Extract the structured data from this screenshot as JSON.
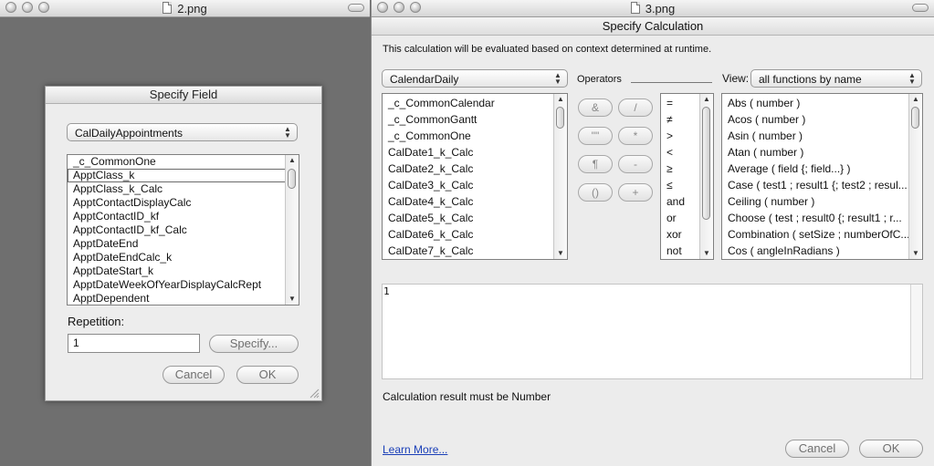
{
  "left_window": {
    "title": "2.png"
  },
  "right_window": {
    "title": "3.png"
  },
  "specify_field": {
    "title": "Specify Field",
    "table_popup": "CalDailyAppointments",
    "fields": [
      "_c_CommonOne",
      "ApptClass_k",
      "ApptClass_k_Calc",
      "ApptContactDisplayCalc",
      "ApptContactID_kf",
      "ApptContactID_kf_Calc",
      "ApptDateEnd",
      "ApptDateEndCalc_k",
      "ApptDateStart_k",
      "ApptDateWeekOfYearDisplayCalcRept",
      "ApptDependent"
    ],
    "selected_field": "ApptClass_k",
    "repetition_label": "Repetition:",
    "repetition_value": "1",
    "specify_button": "Specify...",
    "cancel_button": "Cancel",
    "ok_button": "OK"
  },
  "specify_calc": {
    "title": "Specify Calculation",
    "context_text": "This calculation will be evaluated based on context determined at runtime.",
    "table_popup": "CalendarDaily",
    "operators_label": "Operators",
    "view_label": "View:",
    "view_popup": "all functions by name",
    "fields": [
      "_c_CommonCalendar",
      "_c_CommonGantt",
      "_c_CommonOne",
      "CalDate1_k_Calc",
      "CalDate2_k_Calc",
      "CalDate3_k_Calc",
      "CalDate4_k_Calc",
      "CalDate5_k_Calc",
      "CalDate6_k_Calc",
      "CalDate7_k_Calc"
    ],
    "operator_buttons": [
      "&",
      "/",
      "\"\"",
      "*",
      "¶",
      "-",
      "()",
      "+"
    ],
    "comparison_ops": [
      "=",
      "≠",
      ">",
      "<",
      "≥",
      "≤",
      "and",
      "or",
      "xor",
      "not"
    ],
    "functions": [
      "Abs ( number )",
      "Acos ( number )",
      "Asin ( number )",
      "Atan ( number )",
      "Average ( field {; field...} )",
      "Case ( test1 ; result1 {; test2 ; resul...",
      "Ceiling ( number )",
      "Choose ( test ; result0 {; result1 ; r...",
      "Combination ( setSize ; numberOfC...",
      "Cos ( angleInRadians )"
    ],
    "formula": "1",
    "result_text": "Calculation result must be Number",
    "learn_more": "Learn More...",
    "cancel_button": "Cancel",
    "ok_button": "OK"
  }
}
